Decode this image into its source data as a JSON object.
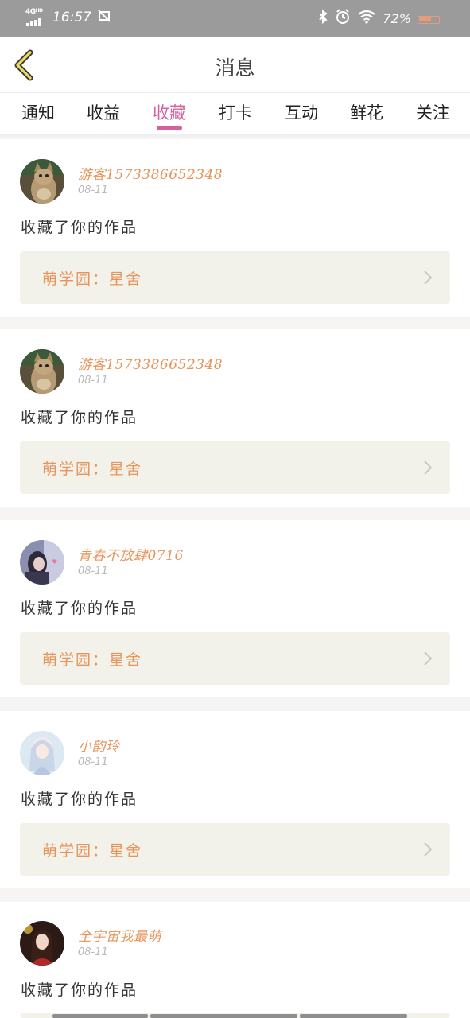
{
  "status_bar": {
    "network": "4G",
    "network_sup": "HD",
    "time": "16:57",
    "battery_percent": "72%",
    "icons": [
      "signal-icon",
      "screenshot-icon",
      "bluetooth-icon",
      "alarm-icon",
      "wifi-icon",
      "battery-icon"
    ]
  },
  "header": {
    "title": "消息",
    "back_icon": "chevron-left-icon"
  },
  "tabs": [
    {
      "label": "通知",
      "active": false
    },
    {
      "label": "收益",
      "active": false
    },
    {
      "label": "收藏",
      "active": true
    },
    {
      "label": "打卡",
      "active": false
    },
    {
      "label": "互动",
      "active": false
    },
    {
      "label": "鲜花",
      "active": false
    },
    {
      "label": "关注",
      "active": false
    }
  ],
  "messages": [
    {
      "user": "游客1573386652348",
      "date": "08-11",
      "action": "收藏了你的作品",
      "work": "萌学园：星舍",
      "avatar_icon": "cat-avatar"
    },
    {
      "user": "游客1573386652348",
      "date": "08-11",
      "action": "收藏了你的作品",
      "work": "萌学园：星舍",
      "avatar_icon": "cat-avatar"
    },
    {
      "user": "青春不放肆0716",
      "date": "08-11",
      "action": "收藏了你的作品",
      "work": "萌学园：星舍",
      "avatar_icon": "portrait-avatar"
    },
    {
      "user": "小韵玲",
      "date": "08-11",
      "action": "收藏了你的作品",
      "work": "萌学园：星舍",
      "avatar_icon": "anime-girl-avatar"
    },
    {
      "user": "全宇宙我最萌",
      "date": "08-11",
      "action": "收藏了你的作品",
      "work": "",
      "avatar_icon": "anime-girl-avatar"
    }
  ],
  "colors": {
    "accent": "#d9609f",
    "username": "#e7945a",
    "work_box": "#f3f2ea",
    "status_bar": "#9b9b9b"
  }
}
